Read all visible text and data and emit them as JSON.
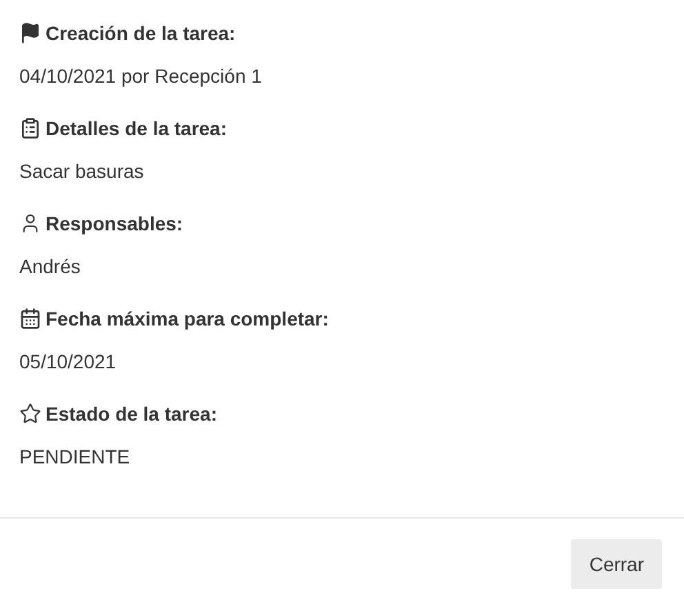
{
  "fields": [
    {
      "label": "Creación de la tarea:",
      "value": "04/10/2021 por Recepción 1"
    },
    {
      "label": "Detalles de la tarea:",
      "value": "Sacar basuras"
    },
    {
      "label": "Responsables:",
      "value": "Andrés"
    },
    {
      "label": "Fecha máxima para completar:",
      "value": "05/10/2021"
    },
    {
      "label": "Estado de la tarea:",
      "value": "PENDIENTE"
    }
  ],
  "buttons": [
    "Cerrar"
  ]
}
